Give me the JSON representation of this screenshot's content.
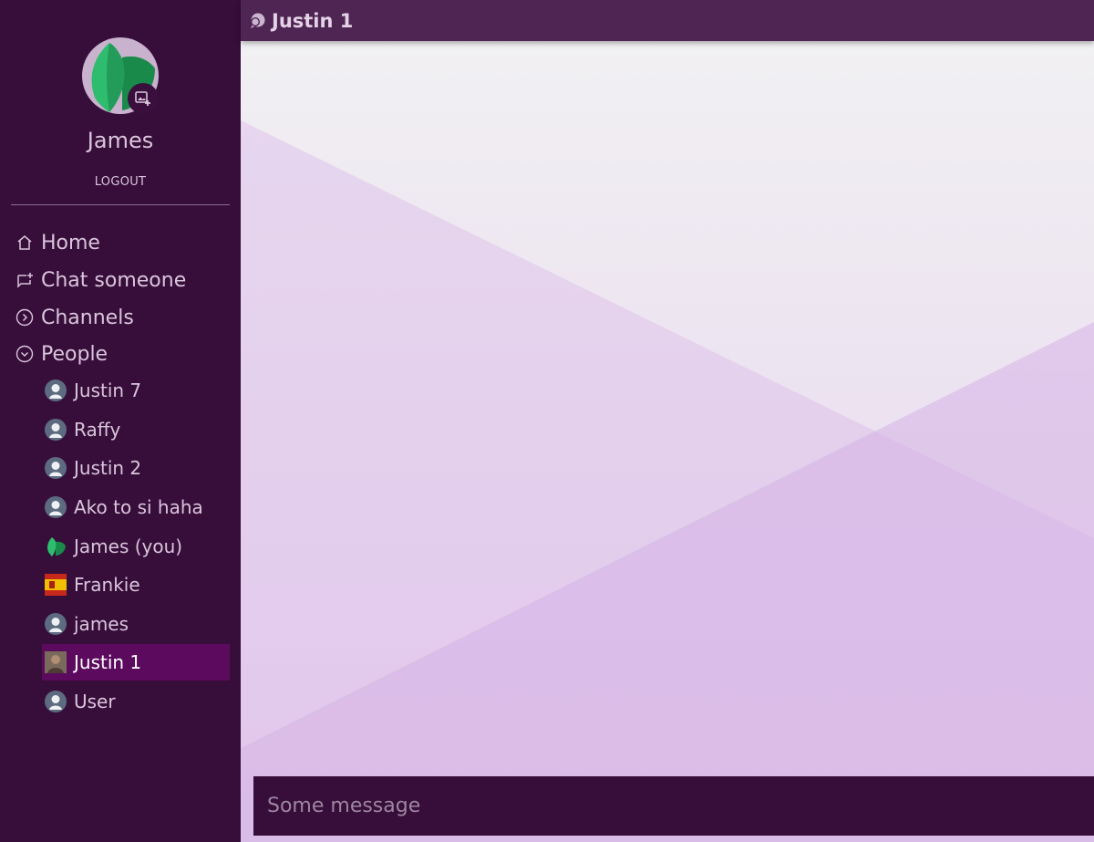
{
  "profile": {
    "name": "James",
    "logout_label": "LOGOUT"
  },
  "nav": [
    {
      "label": "Home",
      "icon": "home-icon"
    },
    {
      "label": "Chat someone",
      "icon": "new-chat-icon"
    },
    {
      "label": "Channels",
      "icon": "chevron-right-circle-icon"
    },
    {
      "label": "People",
      "icon": "chevron-down-circle-icon"
    }
  ],
  "people": [
    {
      "name": "Justin 7",
      "avatar": "default-avatar-icon"
    },
    {
      "name": "Raffy",
      "avatar": "default-avatar-icon"
    },
    {
      "name": "Justin 2",
      "avatar": "default-avatar-icon"
    },
    {
      "name": "Ako to si haha",
      "avatar": "default-avatar-icon"
    },
    {
      "name": "James (you)",
      "avatar": "leaf-avatar-icon"
    },
    {
      "name": "Frankie",
      "avatar": "flag-avatar-icon"
    },
    {
      "name": "james",
      "avatar": "default-avatar-icon"
    },
    {
      "name": "Justin 1",
      "avatar": "photo-avatar-icon",
      "active": true
    },
    {
      "name": "User",
      "avatar": "default-avatar-icon"
    }
  ],
  "chat": {
    "title": "Justin 1",
    "icon": "chat-bubble-icon"
  },
  "composer": {
    "placeholder": "Some message"
  },
  "colors": {
    "sidebar": "#370d3a",
    "topbar": "#4f2554",
    "active_person": "#5b0a5e",
    "accent_green": "#2ebd6e"
  }
}
